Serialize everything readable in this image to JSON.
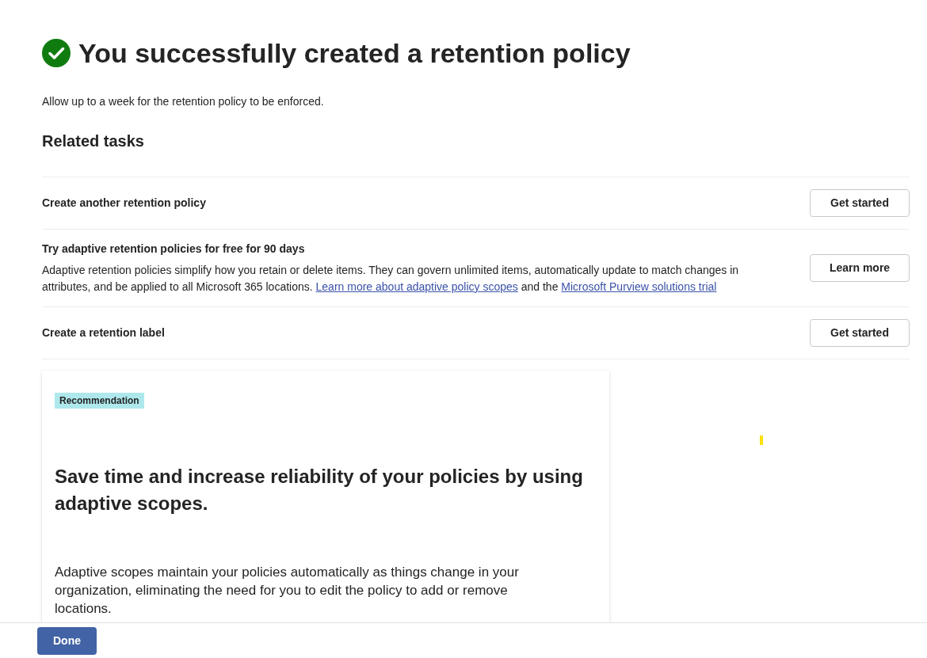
{
  "header": {
    "title": "You successfully created a retention policy",
    "subtitle": "Allow up to a week for the retention policy to be enforced."
  },
  "related_tasks": {
    "heading": "Related tasks",
    "tasks": [
      {
        "title": "Create another retention policy",
        "button": "Get started"
      },
      {
        "title": "Try adaptive retention policies for free for 90 days",
        "description": [
          {
            "kind": "text",
            "text": "Adaptive retention policies simplify how you retain or delete items. They can govern unlimited items, automatically update to match changes in attributes, and be applied to all Microsoft 365 locations. "
          },
          {
            "kind": "link",
            "text": "Learn more about adaptive policy scopes"
          },
          {
            "kind": "text",
            "text": " and the "
          },
          {
            "kind": "link",
            "text": "Microsoft Purview solutions trial"
          }
        ],
        "button": "Learn more"
      },
      {
        "title": "Create a retention label",
        "button": "Get started"
      }
    ]
  },
  "recommendation_card": {
    "badge": "Recommendation",
    "title": "Save time and increase reliability of your policies by using adaptive scopes.",
    "body": "Adaptive scopes maintain your policies automatically as things change in your organization, eliminating the need for you to edit the policy to add or remove locations."
  },
  "footer": {
    "button": "Done"
  }
}
